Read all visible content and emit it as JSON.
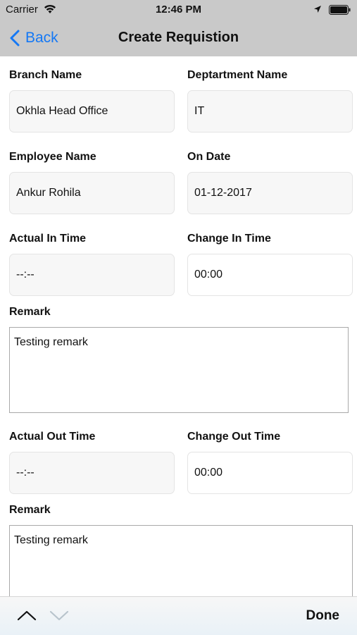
{
  "status_bar": {
    "carrier": "Carrier",
    "time": "12:46 PM"
  },
  "nav": {
    "back_label": "Back",
    "title": "Create Requistion"
  },
  "form": {
    "branch_name": {
      "label": "Branch Name",
      "value": "Okhla Head Office"
    },
    "department_name": {
      "label": "Deptartment Name",
      "value": "IT"
    },
    "employee_name": {
      "label": "Employee Name",
      "value": "Ankur Rohila"
    },
    "on_date": {
      "label": "On Date",
      "value": "01-12-2017"
    },
    "actual_in_time": {
      "label": "Actual In Time",
      "value": "--:--"
    },
    "change_in_time": {
      "label": "Change In Time",
      "value": "00:00"
    },
    "remark_in": {
      "label": "Remark",
      "value": "Testing remark"
    },
    "actual_out_time": {
      "label": "Actual Out Time",
      "value": "--:--"
    },
    "change_out_time": {
      "label": "Change Out Time",
      "value": "00:00"
    },
    "remark_out": {
      "label": "Remark",
      "value": "Testing remark"
    }
  },
  "toolbar": {
    "done_label": "Done"
  },
  "colors": {
    "accent": "#1478f5",
    "bar": "#c9c9c9",
    "disabled_field": "#f7f7f7"
  }
}
